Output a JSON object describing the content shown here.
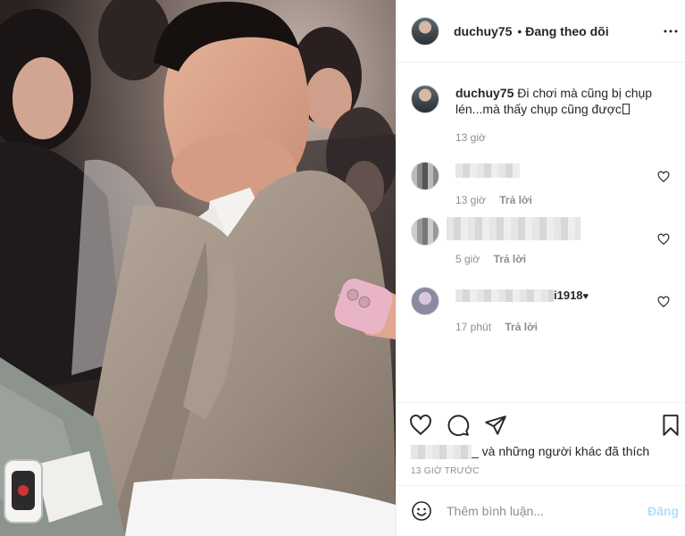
{
  "post": {
    "username": "duchuy75",
    "separator": "•",
    "follow_status": "Đang theo dõi",
    "more_icon": "more-horizontal-icon"
  },
  "caption": {
    "username": "duchuy75",
    "text": "Đi chơi mà cũng bị chụp lén...mà thấy chụp cũng được",
    "time": "13 giờ"
  },
  "comments": [
    {
      "time": "13 giờ",
      "reply": "Trả lời"
    },
    {
      "time": "5 giờ",
      "reply": "Trả lời"
    },
    {
      "username_visible": "i1918",
      "time": "17 phút",
      "reply": "Trả lời"
    }
  ],
  "actions": {
    "like_icon": "heart-icon",
    "comment_icon": "comment-icon",
    "share_icon": "share-icon",
    "save_icon": "bookmark-icon",
    "liked_by_suffix": "_ và những người khác đã thích",
    "timestamp": "13 GIỜ TRƯỚC"
  },
  "composer": {
    "placeholder": "Thêm bình luận...",
    "post_label": "Đăng",
    "emoji_icon": "emoji-icon"
  },
  "colors": {
    "text": "#262626",
    "muted": "#8e8e8e",
    "link_disabled": "#b2dffc",
    "border": "#efefef"
  }
}
